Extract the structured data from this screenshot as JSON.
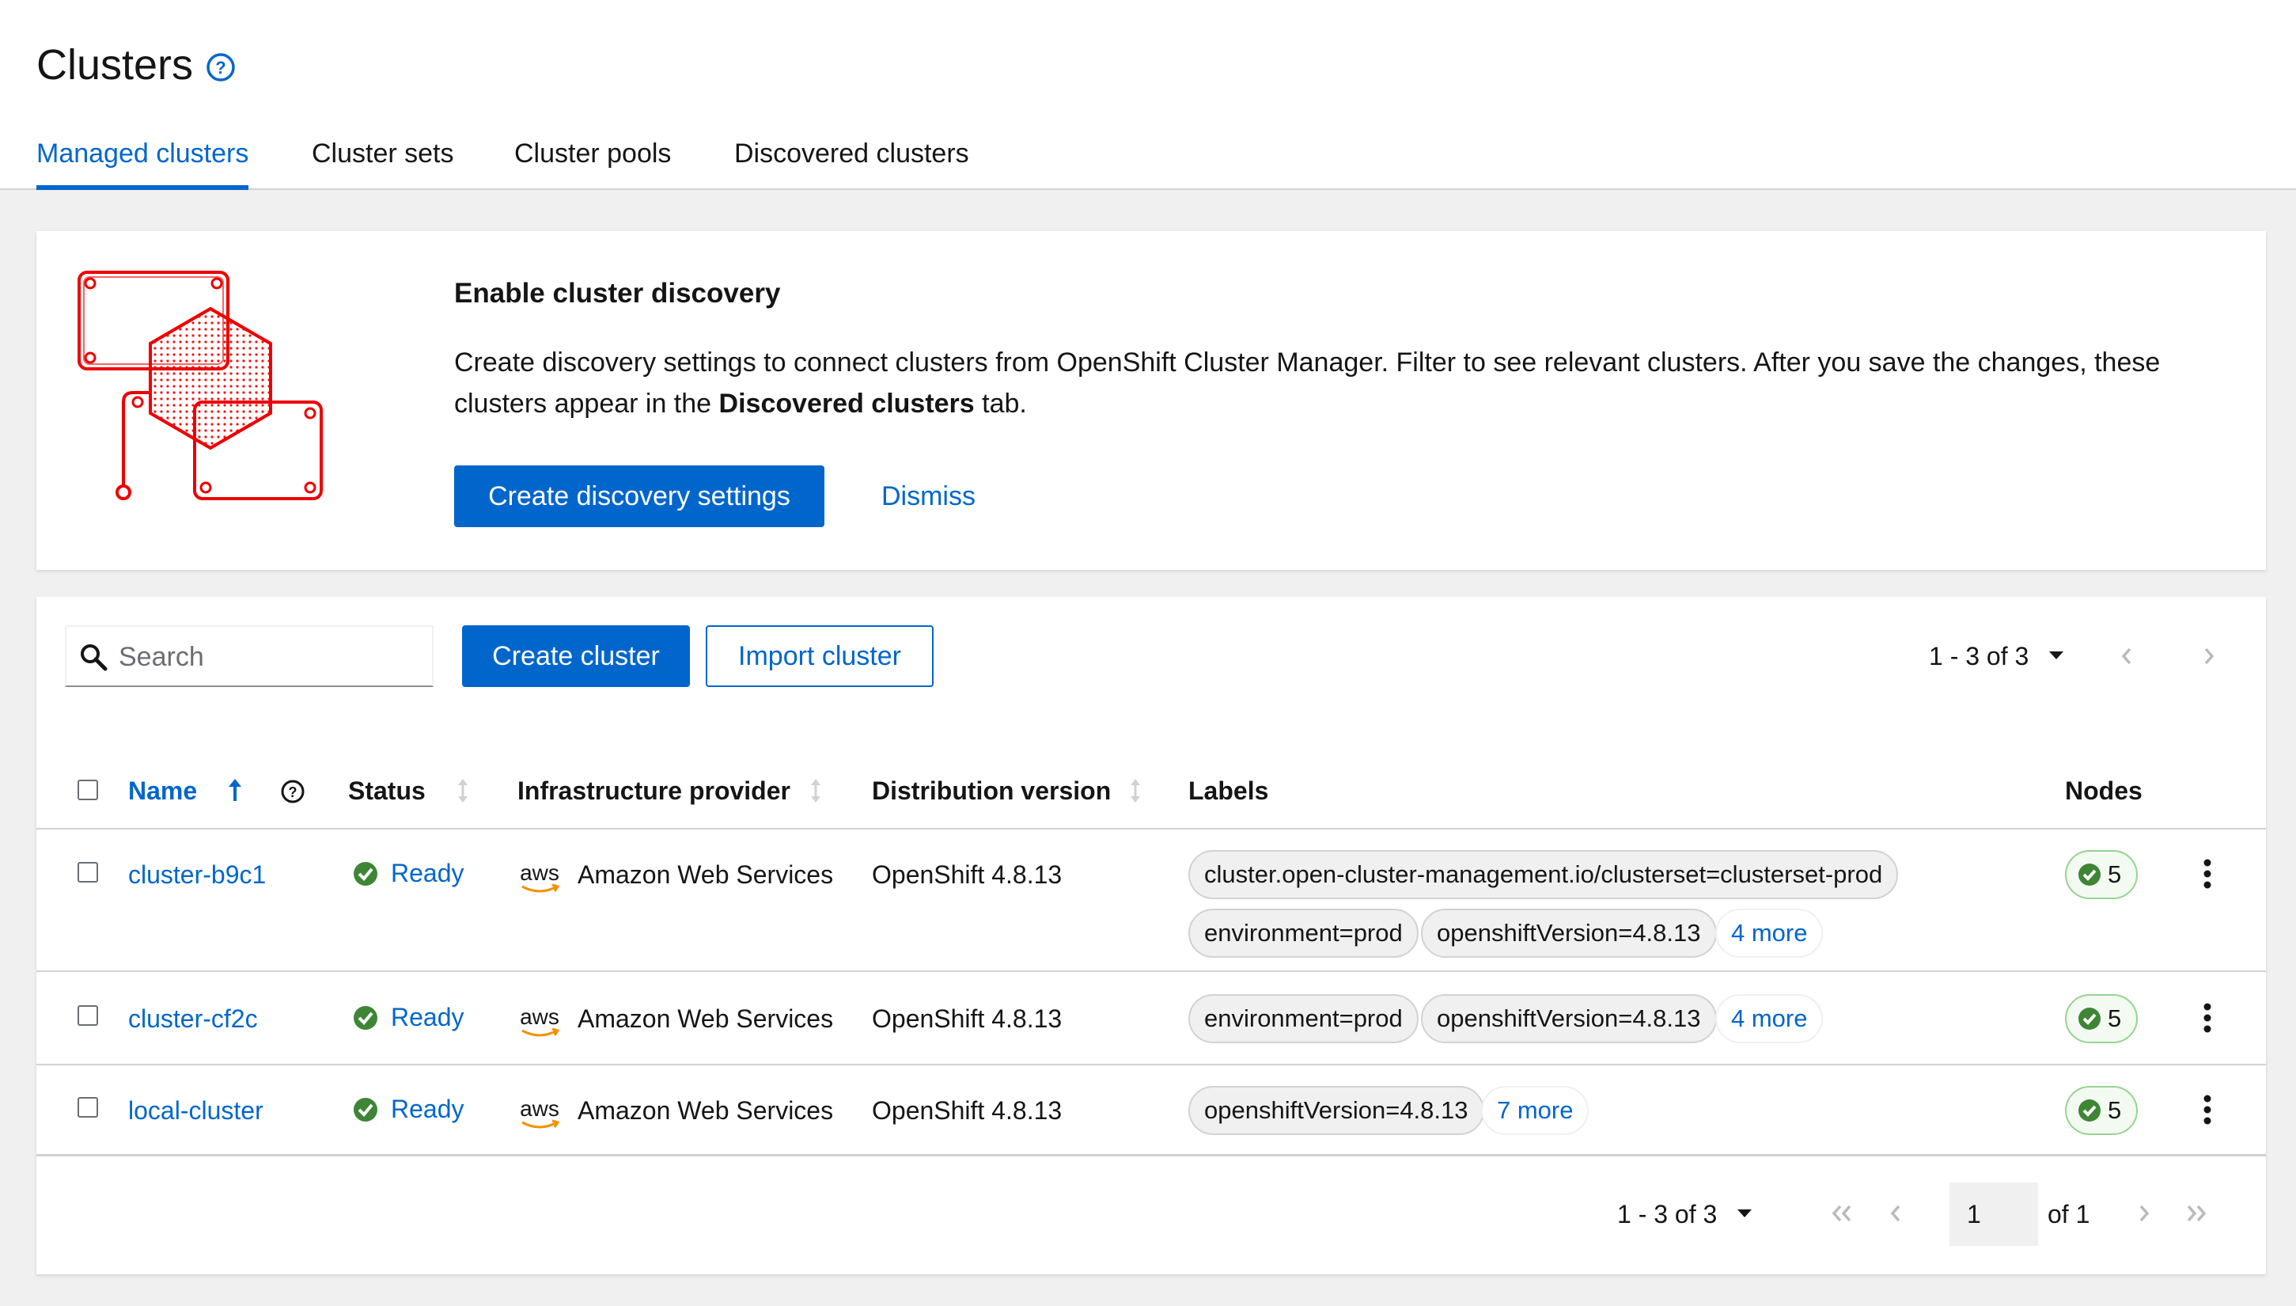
{
  "page": {
    "title": "Clusters"
  },
  "tabs": [
    {
      "label": "Managed clusters",
      "active": true
    },
    {
      "label": "Cluster sets",
      "active": false
    },
    {
      "label": "Cluster pools",
      "active": false
    },
    {
      "label": "Discovered clusters",
      "active": false
    }
  ],
  "discovery": {
    "title": "Enable cluster discovery",
    "body_prefix": "Create discovery settings to connect clusters from OpenShift Cluster Manager. Filter to see relevant clusters. After you save the changes, these clusters appear in the ",
    "body_bold": "Discovered clusters",
    "body_suffix": " tab.",
    "primary_button": "Create discovery settings",
    "dismiss_link": "Dismiss"
  },
  "toolbar": {
    "search_placeholder": "Search",
    "create_button": "Create cluster",
    "import_button": "Import cluster",
    "pagination_label": "1 - 3 of 3"
  },
  "table": {
    "columns": {
      "name": "Name",
      "status": "Status",
      "provider": "Infrastructure provider",
      "distribution": "Distribution version",
      "labels": "Labels",
      "nodes": "Nodes"
    },
    "rows": [
      {
        "name": "cluster-b9c1",
        "status": "Ready",
        "provider_logo": "aws",
        "provider": "Amazon Web Services",
        "distribution": "OpenShift 4.8.13",
        "labels": [
          "cluster.open-cluster-management.io/clusterset=clusterset-prod",
          "environment=prod",
          "openshiftVersion=4.8.13"
        ],
        "more_labels": "4 more",
        "nodes": "5"
      },
      {
        "name": "cluster-cf2c",
        "status": "Ready",
        "provider_logo": "aws",
        "provider": "Amazon Web Services",
        "distribution": "OpenShift 4.8.13",
        "labels": [
          "environment=prod",
          "openshiftVersion=4.8.13"
        ],
        "more_labels": "4 more",
        "nodes": "5"
      },
      {
        "name": "local-cluster",
        "status": "Ready",
        "provider_logo": "aws",
        "provider": "Amazon Web Services",
        "distribution": "OpenShift 4.8.13",
        "labels": [
          "openshiftVersion=4.8.13"
        ],
        "more_labels": "7 more",
        "nodes": "5"
      }
    ]
  },
  "footer_pagination": {
    "range_label": "1 - 3 of 3",
    "page_value": "1",
    "of_pages": "of 1"
  },
  "colors": {
    "accent": "#0066cc",
    "success": "#3e8635",
    "brand_red": "#ee0000"
  }
}
